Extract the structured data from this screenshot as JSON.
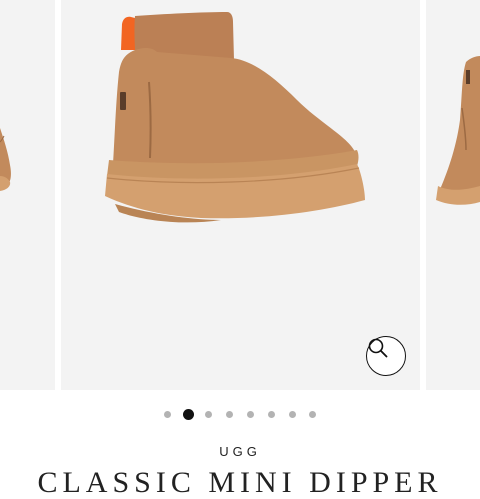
{
  "product": {
    "brand": "UGG",
    "name": "CLASSIC MINI DIPPER"
  },
  "gallery": {
    "slide_count": 8,
    "active_index": 1,
    "zoom_icon": "magnifier-icon"
  },
  "colors": {
    "slide_bg": "#f3f3f3",
    "suede": "#c28a5c",
    "sole": "#d4a06f",
    "pull_tab": "#f26522",
    "active_dot": "#111111",
    "inactive_dot": "#b3b3b3"
  }
}
